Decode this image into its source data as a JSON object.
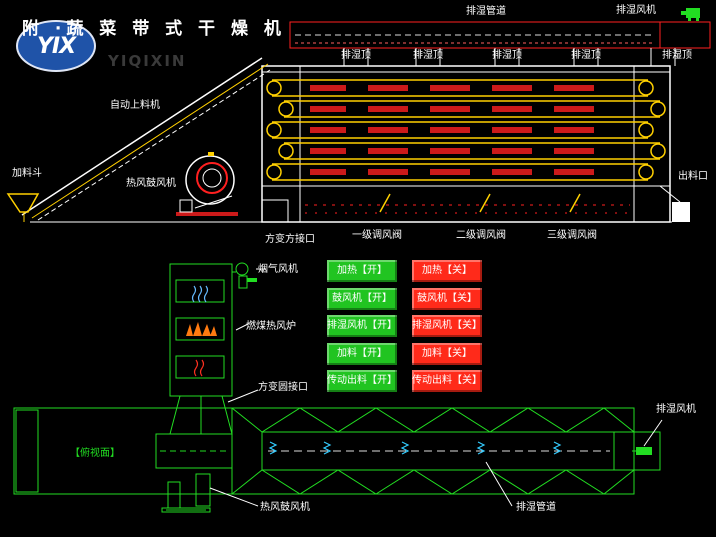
{
  "header": {
    "title": "附 ·蔬 菜 带 式 干 燥 机",
    "brand_logo_text": "YIX",
    "brand_en": "YIQIXIN"
  },
  "top_labels": {
    "exhaust_pipe": "排湿管道",
    "exhaust_fan": "排湿风机",
    "vents": [
      "排湿顶",
      "排湿顶",
      "排湿顶",
      "排湿顶",
      "排湿顶"
    ]
  },
  "machine_labels": {
    "auto_feeder": "自动上料机",
    "hopper": "加料斗",
    "hot_air_fan": "热风鼓风机",
    "outlet": "出料口",
    "square_to_round": "方变方接口",
    "damper_1": "一级调风阀",
    "damper_2": "二级调风阀",
    "damper_3": "三级调风阀"
  },
  "furnace_labels": {
    "draft_fan": "烟气风机",
    "coal_furnace": "燃煤热风炉",
    "square_round": "方变圆接口"
  },
  "controls": {
    "rows": [
      {
        "on": "加热【开】",
        "off": "加热【关】"
      },
      {
        "on": "鼓风机【开】",
        "off": "鼓风机【关】"
      },
      {
        "on": "排湿风机【开】",
        "off": "排湿风机【关】"
      },
      {
        "on": "加料【开】",
        "off": "加料【关】"
      },
      {
        "on": "传动出料【开】",
        "off": "传动出料【关】"
      }
    ],
    "colors": {
      "on": "#21c421",
      "off": "#ff2a1a"
    }
  },
  "plan_view": {
    "label": "【俯视面】",
    "exhaust_fan": "排湿风机",
    "hot_air_fan": "热风鼓风机",
    "exhaust_pipe": "排湿管道"
  }
}
